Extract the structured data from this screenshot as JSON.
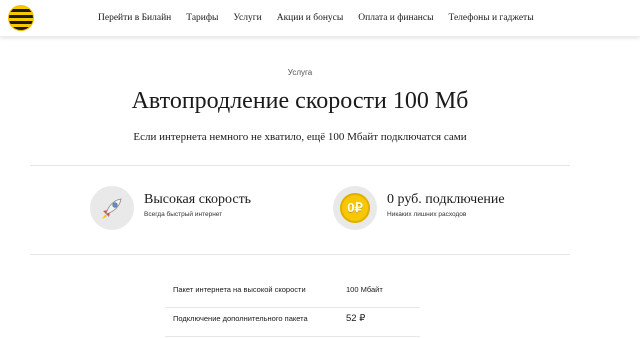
{
  "header": {
    "logo_icon": "beeline-striped-ball-logo",
    "nav": [
      {
        "label": "Перейти в Билайн"
      },
      {
        "label": "Тарифы"
      },
      {
        "label": "Услуги"
      },
      {
        "label": "Акции и бонусы"
      },
      {
        "label": "Оплата и финансы"
      },
      {
        "label": "Телефоны и гаджеты"
      }
    ]
  },
  "hero": {
    "eyebrow": "Услуга",
    "title": "Автопродление скорости 100 Мб",
    "subtitle": "Если интернета немного не хватило, ещё 100 Мбайт подключатся сами"
  },
  "features": [
    {
      "icon": "rocket-icon",
      "title": "Высокая скорость",
      "description": "Всегда быстрый интернет"
    },
    {
      "icon": "zero-ruble-coin-icon",
      "coin_text": "0₽",
      "title": "0 руб. подключение",
      "description": "Никаких лишних расходов"
    }
  ],
  "details": [
    {
      "label": "Пакет интернета на высокой скорости",
      "value": "100 Мбайт"
    },
    {
      "label": "Подключение дополнительного пакета",
      "value": "52 ₽"
    }
  ],
  "colors": {
    "brand_yellow": "#f7c800",
    "text": "#1a1a1a",
    "icon_bg": "#e9e9e9",
    "divider": "#e6e6e6"
  }
}
